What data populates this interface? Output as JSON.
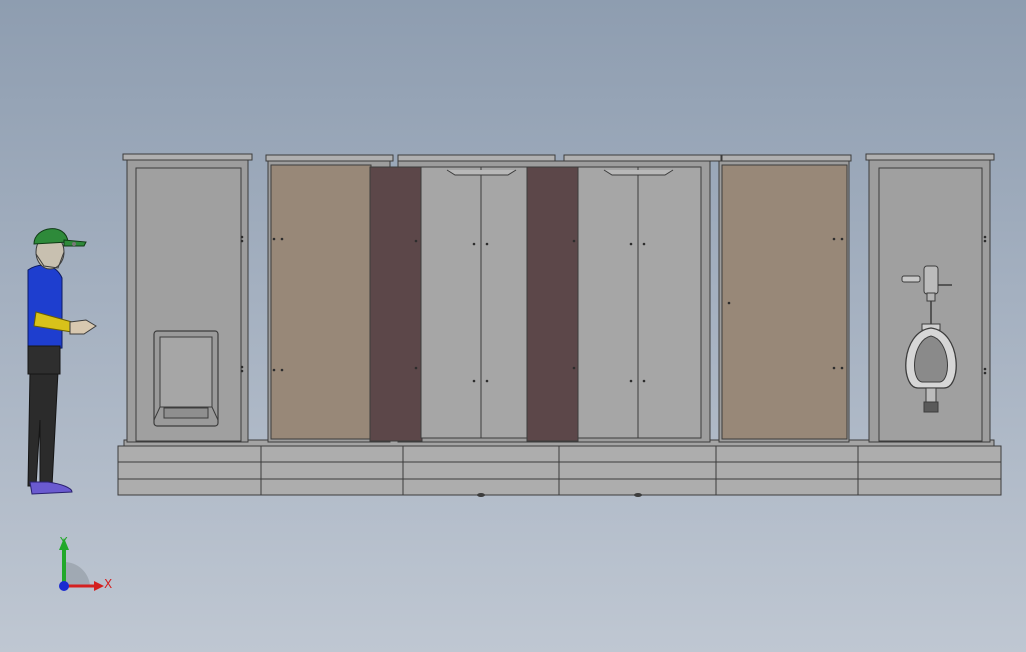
{
  "viewport": {
    "background_top": "#8e9db0",
    "background_bottom": "#bfc7d2"
  },
  "scene": {
    "model": "restroom-cabin-assembly",
    "colors": {
      "panel": "#9d9d9d",
      "panel_light": "#a8a8a8",
      "outline": "#3c3c3c",
      "door_tan": "#988878",
      "door_maroon": "#5c4749",
      "base": "#adadad",
      "figure_shirt": "#1e3ecf",
      "figure_cap": "#2e8a3a",
      "figure_pants": "#2b2b2b",
      "figure_shoe": "#6a5ad0",
      "figure_sleeve": "#d8c21a"
    }
  },
  "triad": {
    "x_label": "X",
    "y_label": "Y",
    "x_color": "#d42020",
    "y_color": "#22a82a",
    "origin_color": "#1a2ad0"
  }
}
